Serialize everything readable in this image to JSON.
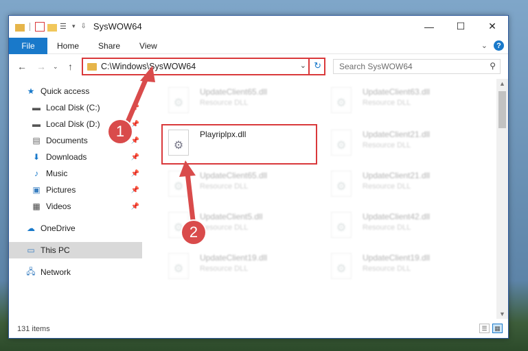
{
  "window": {
    "title": "SysWOW64"
  },
  "ribbon": {
    "tabs": [
      "File",
      "Home",
      "Share",
      "View"
    ],
    "help": "?"
  },
  "address": {
    "path": "C:\\Windows\\SysWOW64"
  },
  "search": {
    "placeholder": "Search SysWOW64"
  },
  "sidebar": {
    "items": [
      {
        "label": "Quick access",
        "icon": "star-icon",
        "pinned": false
      },
      {
        "label": "Local Disk (C:)",
        "icon": "drive-icon",
        "pinned": true
      },
      {
        "label": "Local Disk (D:)",
        "icon": "drive-icon",
        "pinned": true
      },
      {
        "label": "Documents",
        "icon": "document-icon",
        "pinned": true
      },
      {
        "label": "Downloads",
        "icon": "download-icon",
        "pinned": true
      },
      {
        "label": "Music",
        "icon": "music-icon",
        "pinned": true
      },
      {
        "label": "Pictures",
        "icon": "picture-icon",
        "pinned": true
      },
      {
        "label": "Videos",
        "icon": "video-icon",
        "pinned": true
      },
      {
        "label": "OneDrive",
        "icon": "cloud-icon",
        "pinned": false
      },
      {
        "label": "This PC",
        "icon": "computer-icon",
        "pinned": false,
        "selected": true
      },
      {
        "label": "Network",
        "icon": "network-icon",
        "pinned": false
      }
    ]
  },
  "files": [
    {
      "name": "UpdateClient65.dll",
      "type": "Resource DLL",
      "blurred": true
    },
    {
      "name": "UpdateClient63.dll",
      "type": "Resource DLL",
      "blurred": true
    },
    {
      "name": "Playriplpx.dll",
      "type": "",
      "blurred": false,
      "highlighted": true
    },
    {
      "name": "UpdateClient21.dll",
      "type": "Resource DLL",
      "blurred": true
    },
    {
      "name": "UpdateClient65.dll",
      "type": "Resource DLL",
      "blurred": true
    },
    {
      "name": "UpdateClient21.dll",
      "type": "Resource DLL",
      "blurred": true
    },
    {
      "name": "UpdateClient5.dll",
      "type": "Resource DLL",
      "blurred": true
    },
    {
      "name": "UpdateClient42.dll",
      "type": "Resource DLL",
      "blurred": true
    },
    {
      "name": "UpdateClient19.dll",
      "type": "Resource DLL",
      "blurred": true
    },
    {
      "name": "UpdateClient19.dll",
      "type": "Resource DLL",
      "blurred": true
    }
  ],
  "status": {
    "item_count": "131 items"
  },
  "annotations": {
    "step1": "1",
    "step2": "2"
  },
  "colors": {
    "accent": "#1979ca",
    "highlight": "#d9383a",
    "badge": "#d94b4b"
  }
}
